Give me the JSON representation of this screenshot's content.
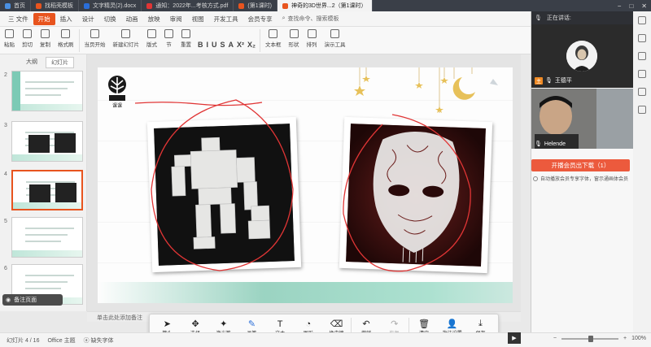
{
  "colors": {
    "accent": "#e8541e",
    "download": "#ec5a3d",
    "ink": "#e03535",
    "dark_bar": "#3a3f48"
  },
  "doc_tabs": [
    {
      "label": "首页",
      "color": "#4a90e2"
    },
    {
      "label": "找稻壳模板",
      "color": "#e8541e"
    },
    {
      "label": "文字精灵(2).docx",
      "color": "#2a6ed8"
    },
    {
      "label": "通知：2022年...考核方式.pdf",
      "color": "#e03535"
    },
    {
      "label": "(第1课时)",
      "color": "#e8541e"
    },
    {
      "label": "神奇的3D世界...2（第1课时）",
      "color": "#e8541e"
    }
  ],
  "menu": {
    "file_label": "三 文件",
    "items": [
      "开始",
      "插入",
      "设计",
      "切换",
      "动画",
      "放映",
      "审阅",
      "视图",
      "开发工具",
      "会员专享"
    ],
    "active": "开始",
    "search": "查找命令、搜索模板"
  },
  "ribbon": {
    "buttons": [
      "粘贴",
      "剪切",
      "复制",
      "格式刷",
      "当页开始",
      "新建幻灯片",
      "版式",
      "节",
      "重置",
      "文本框",
      "形状",
      "排列",
      "演示工具"
    ],
    "format_glyphs": [
      "B",
      "I",
      "U",
      "S",
      "A",
      "X²",
      "X₂"
    ]
  },
  "left_panel": {
    "tabs": [
      "大纲",
      "幻灯片"
    ],
    "active_tab": "幻灯片",
    "slides": [
      {
        "num": "2",
        "selected": false
      },
      {
        "num": "3",
        "selected": false
      },
      {
        "num": "4",
        "selected": true
      },
      {
        "num": "5",
        "selected": false
      },
      {
        "num": "6",
        "selected": false
      }
    ],
    "notes_pill": "备注页面"
  },
  "slide": {
    "logo_text": "课课",
    "logo_subtext": "智慧课堂课堂"
  },
  "notes_placeholder": "单击此处添加备注",
  "pen_toolbar": [
    {
      "label": "箭头",
      "icon": "cursor-arrow-icon",
      "glyph": "➤",
      "state": "normal"
    },
    {
      "label": "选择",
      "icon": "move-icon",
      "glyph": "✥",
      "state": "normal"
    },
    {
      "label": "激光笔",
      "icon": "laser-pointer-icon",
      "glyph": "✦",
      "state": "normal"
    },
    {
      "label": "画笔",
      "icon": "pen-icon",
      "glyph": "✎",
      "state": "active"
    },
    {
      "label": "文本",
      "icon": "text-icon",
      "glyph": "T",
      "state": "normal"
    },
    {
      "label": "图形",
      "icon": "shapes-icon",
      "glyph": "◔",
      "state": "normal"
    },
    {
      "label": "橡皮擦",
      "icon": "eraser-icon",
      "glyph": "⌫",
      "state": "normal"
    },
    {
      "label": "撤销",
      "icon": "undo-icon",
      "glyph": "↶",
      "state": "normal"
    },
    {
      "label": "恢复",
      "icon": "redo-icon",
      "glyph": "↷",
      "state": "disabled"
    },
    {
      "label": "清空",
      "icon": "trash-icon",
      "glyph": "🗑",
      "state": "normal"
    },
    {
      "label": "批注设置",
      "icon": "settings-user-icon",
      "glyph": "👤",
      "state": "normal"
    },
    {
      "label": "保存",
      "icon": "save-download-icon",
      "glyph": "⤓",
      "state": "normal"
    }
  ],
  "status": {
    "slide_counter": "幻灯片 4 / 16",
    "theme": "Office 主题",
    "font_missing": "缺失字体",
    "zoom": "100%"
  },
  "meeting": {
    "header": "正在讲话:",
    "host_badge": "主",
    "host_name": "王德平",
    "participant_name": "Helende",
    "download_btn": "开播会员出下载（1）",
    "consent": "自动播放会员专享字体，窗示通画体会员"
  }
}
